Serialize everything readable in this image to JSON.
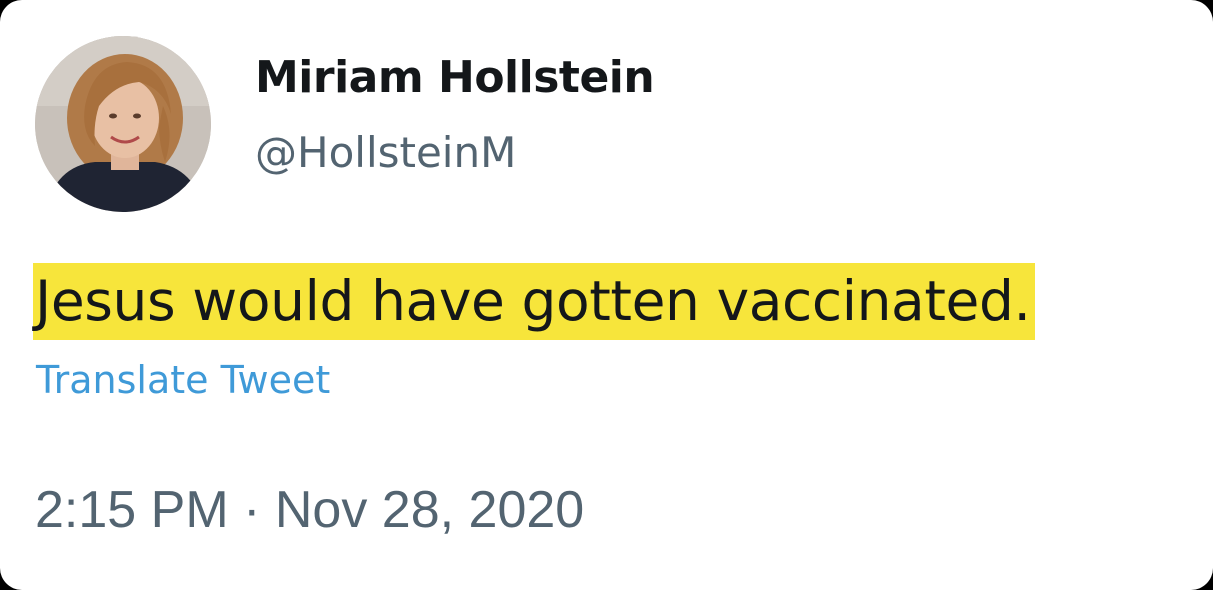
{
  "tweet": {
    "author": {
      "display_name": "Miriam Hollstein",
      "handle": "@HollsteinM",
      "avatar_icon": "profile-photo"
    },
    "text": "Jesus would have gotten vaccinated.",
    "translate_label": "Translate Tweet",
    "timestamp": "2:15 PM · Nov 28, 2020"
  },
  "colors": {
    "card_background": "#ffffff",
    "highlight": "#f7e53b",
    "link": "#3f9ad8",
    "primary_text": "#14171a",
    "secondary_text": "#536471"
  }
}
